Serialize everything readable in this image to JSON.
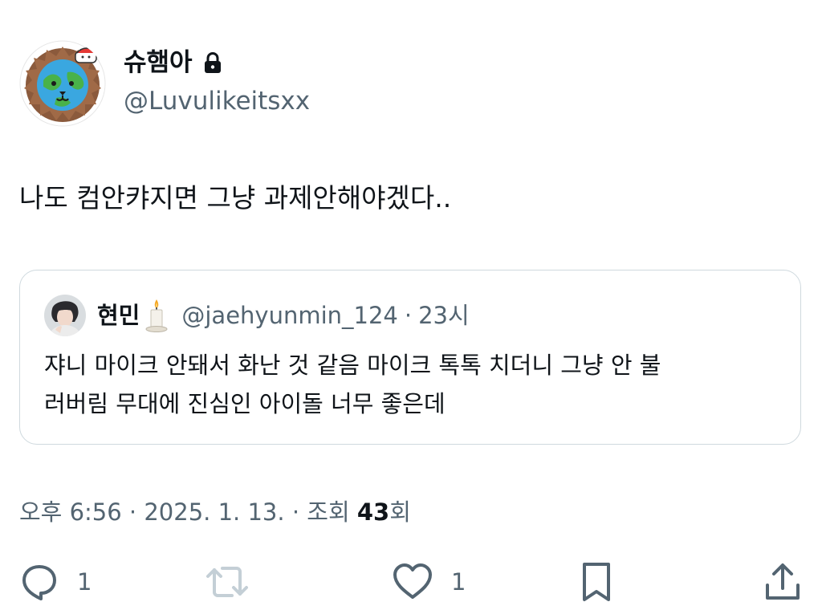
{
  "tweet": {
    "author": {
      "display_name": "슈햄아",
      "handle": "@Luvulikeitsxx",
      "avatar": "lion-globe-avatar",
      "protected_icon": "lock-icon"
    },
    "text": "나도 컴안캬지면 그냥 과제안해야겠다..",
    "quoted": {
      "display_name": "현민",
      "name_emoji": "candle-icon",
      "handle": "@jaehyunmin_124",
      "separator": "·",
      "time_ago": "23시",
      "text_line_1": "쟈니 마이크 안돼서 화난 것 같음 마이크 톡톡 치더니 그냥 안 불",
      "text_line_2": "러버림 무대에 진심인 아이돌 너무 좋은데"
    },
    "meta": {
      "time": "오후 6:56",
      "separator": "·",
      "date": "2025. 1. 13.",
      "views_prefix": "조회",
      "views_count": "43",
      "views_suffix": "회"
    },
    "actions": {
      "reply_count": "1",
      "like_count": "1"
    }
  },
  "colors": {
    "text_primary": "#0f1419",
    "text_secondary": "#536471",
    "border": "#cfd9de"
  }
}
